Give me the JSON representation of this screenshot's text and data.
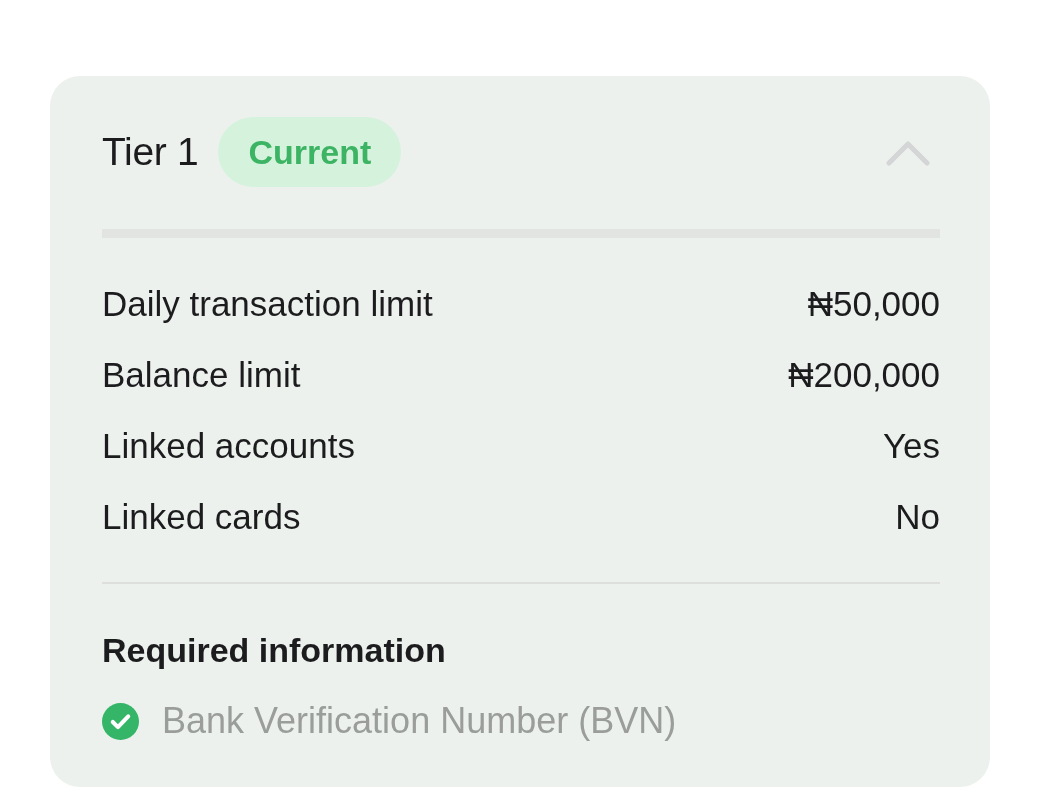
{
  "tier_card": {
    "title": "Tier 1",
    "badge": "Current",
    "expanded": true
  },
  "limits": [
    {
      "label": "Daily transaction limit",
      "value": "₦50,000"
    },
    {
      "label": "Balance limit",
      "value": "₦200,000"
    },
    {
      "label": "Linked accounts",
      "value": "Yes"
    },
    {
      "label": "Linked cards",
      "value": "No"
    }
  ],
  "required_information": {
    "heading": "Required information",
    "items": [
      {
        "label": "Bank Verification Number (BVN)",
        "checked": true
      }
    ]
  }
}
